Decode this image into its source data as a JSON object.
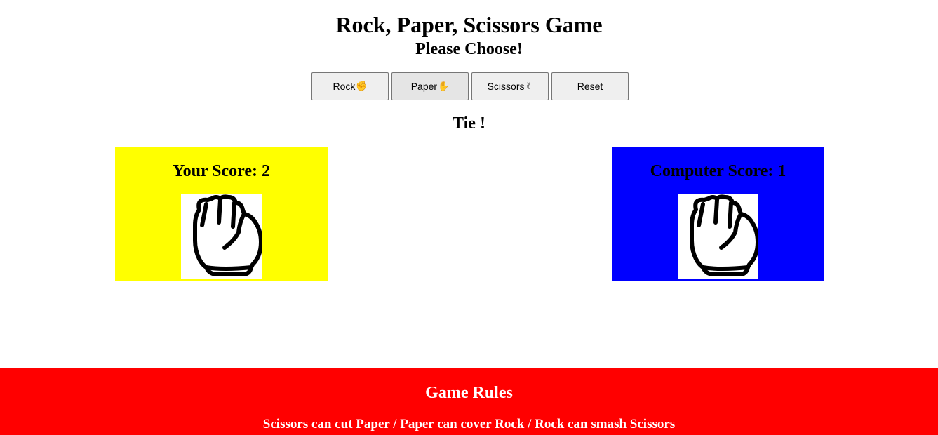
{
  "header": {
    "title": "Rock, Paper, Scissors Game",
    "prompt": "Please Choose!"
  },
  "buttons": {
    "rock": {
      "label": "Rock",
      "emoji": "✊"
    },
    "paper": {
      "label": "Paper",
      "emoji": "✋"
    },
    "scissors": {
      "label": "Scissors",
      "emoji": "✌"
    },
    "reset": {
      "label": "Reset"
    }
  },
  "result": "Tie !",
  "player": {
    "score_label": "Your Score: 2",
    "choice_icon": "paper-hand-icon",
    "color": "#ffff00"
  },
  "computer": {
    "score_label": "Computer Score: 1",
    "choice_icon": "paper-hand-icon",
    "color": "#0000ff"
  },
  "footer": {
    "title": "Game Rules",
    "rules": "Scissors can cut Paper / Paper can cover Rock / Rock can smash Scissors",
    "color": "#ff0000"
  }
}
